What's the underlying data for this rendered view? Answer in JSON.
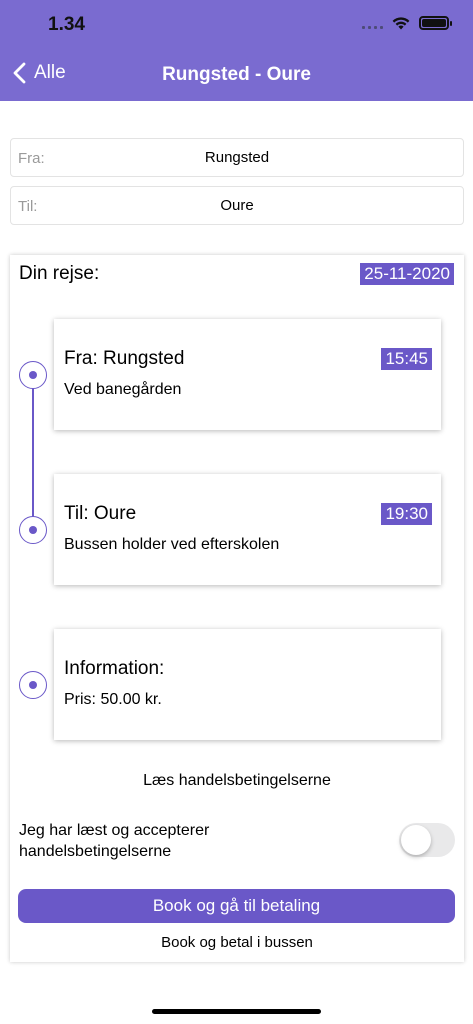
{
  "status_bar": {
    "time": "1.34",
    "icons": [
      "signal-icon",
      "wifi-icon",
      "battery-icon"
    ]
  },
  "nav": {
    "back_label": "Alle",
    "title": "Rungsted - Oure",
    "background_color": "#7a6bd0"
  },
  "form": {
    "from_label": "Fra:",
    "from_value": "Rungsted",
    "to_label": "Til:",
    "to_value": "Oure"
  },
  "journey": {
    "heading": "Din rejse:",
    "date": "25-11-2020",
    "stops": [
      {
        "title": "Fra: Rungsted",
        "subtitle": "Ved banegården",
        "time": "15:45"
      },
      {
        "title": "Til: Oure",
        "subtitle": "Bussen holder ved efterskolen",
        "time": "19:30"
      },
      {
        "title": "Information:",
        "subtitle": "Pris: 50.00 kr."
      }
    ]
  },
  "terms": {
    "link_label": "Læs handelsbetingelserne",
    "accept_label": "Jeg har læst og accepterer handelsbetingelserne",
    "accepted": false
  },
  "actions": {
    "book_pay_label": "Book og gå til betaling",
    "book_bus_label": "Book og betal i bussen"
  },
  "colors": {
    "accent": "#6a58c8",
    "header": "#7a6bd0"
  }
}
